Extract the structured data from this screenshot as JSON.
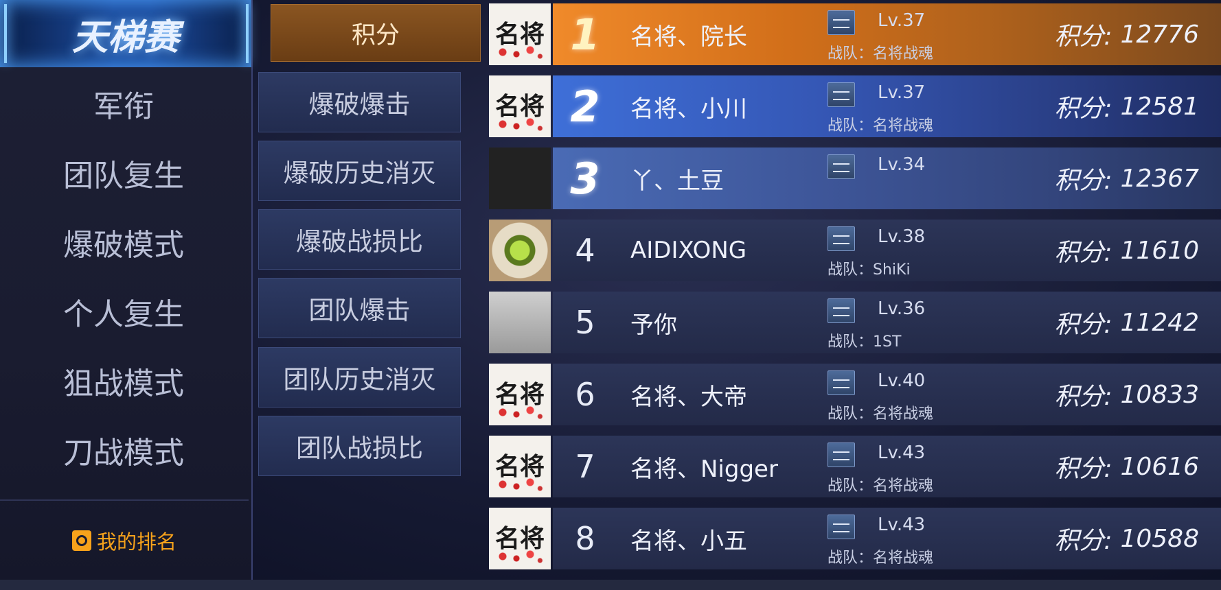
{
  "left_panel": {
    "title": "天梯赛",
    "modes": [
      "军衔",
      "团队复生",
      "爆破模式",
      "个人复生",
      "狙战模式",
      "刀战模式"
    ],
    "my_rank_label": "我的排名"
  },
  "sub_tabs": [
    "积分",
    "爆破爆击",
    "爆破历史消灭",
    "爆破战损比",
    "团队爆击",
    "团队历史消灭",
    "团队战损比"
  ],
  "score_label": "积分:",
  "players": [
    {
      "rank": "1",
      "name": "名将、院长",
      "level": "Lv.37",
      "team": "战队：名将战魂",
      "score": "12776",
      "avatar_text": "名将"
    },
    {
      "rank": "2",
      "name": "名将、小川",
      "level": "Lv.37",
      "team": "战队：名将战魂",
      "score": "12581",
      "avatar_text": "名将"
    },
    {
      "rank": "3",
      "name": "丫、土豆",
      "level": "Lv.34",
      "team": "",
      "score": "12367",
      "avatar_text": ""
    },
    {
      "rank": "4",
      "name": "AIDIXONG",
      "level": "Lv.38",
      "team": "战队：ShiKi",
      "score": "11610",
      "avatar_text": ""
    },
    {
      "rank": "5",
      "name": "予你",
      "level": "Lv.36",
      "team": "战队：1ST",
      "score": "11242",
      "avatar_text": ""
    },
    {
      "rank": "6",
      "name": "名将、大帝",
      "level": "Lv.40",
      "team": "战队：名将战魂",
      "score": "10833",
      "avatar_text": "名将"
    },
    {
      "rank": "7",
      "name": "名将、Nigger",
      "level": "Lv.43",
      "team": "战队：名将战魂",
      "score": "10616",
      "avatar_text": "名将"
    },
    {
      "rank": "8",
      "name": "名将、小五",
      "level": "Lv.43",
      "team": "战队：名将战魂",
      "score": "10588",
      "avatar_text": "名将"
    }
  ]
}
